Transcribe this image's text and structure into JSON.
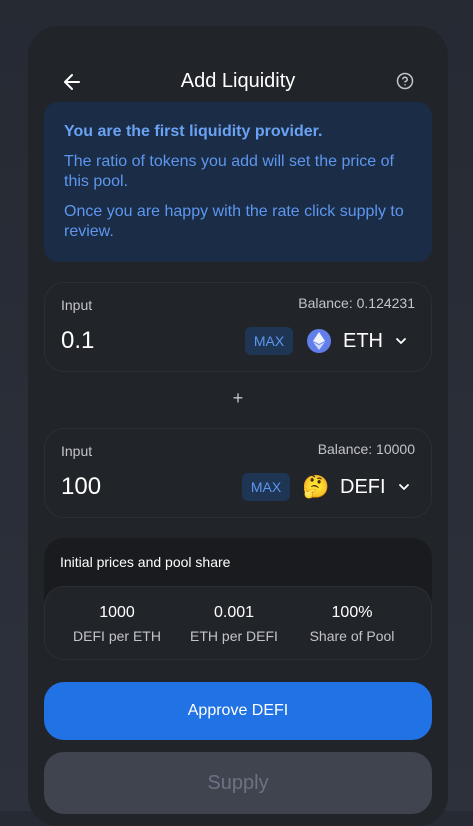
{
  "header": {
    "title": "Add Liquidity"
  },
  "notice": {
    "title": "You are the first liquidity provider.",
    "line1": "The ratio of tokens you add will set the price of this pool.",
    "line2": "Once you are happy with the rate click supply to review."
  },
  "input_a": {
    "label": "Input",
    "balance": "Balance: 0.124231",
    "amount": "0.1",
    "max_label": "MAX",
    "token": "ETH"
  },
  "plus": "+",
  "input_b": {
    "label": "Input",
    "balance": "Balance: 10000",
    "amount": "100",
    "max_label": "MAX",
    "token": "DEFI",
    "token_emoji": "🤔"
  },
  "prices": {
    "title": "Initial prices and pool share",
    "items": [
      {
        "value": "1000",
        "label": "DEFI per ETH"
      },
      {
        "value": "0.001",
        "label": "ETH per DEFI"
      },
      {
        "value": "100%",
        "label": "Share of Pool"
      }
    ]
  },
  "buttons": {
    "approve": "Approve DEFI",
    "supply": "Supply"
  },
  "icons": {
    "back": "arrow-left-icon",
    "help": "question-circle-icon",
    "eth": "ethereum-icon",
    "chevron": "chevron-down-icon"
  },
  "colors": {
    "accent": "#2172e5",
    "notice_bg": "#1b2c46",
    "notice_text": "#5d97ef",
    "card_bg": "#212429"
  }
}
